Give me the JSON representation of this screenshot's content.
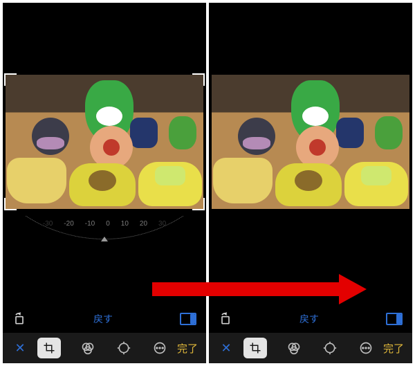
{
  "screens": {
    "left": {
      "reset_label": "戻す",
      "done_label": "完了",
      "show_crop_ui": true
    },
    "right": {
      "reset_label": "戻す",
      "done_label": "完了",
      "show_crop_ui": false
    }
  },
  "dial": {
    "labels": [
      "-30",
      "-20",
      "-10",
      "0",
      "10",
      "20",
      "30"
    ],
    "value": 0
  },
  "colors": {
    "accent_blue": "#2e6fd6",
    "accent_yellow": "#e2b93b",
    "arrow_red": "#e30000"
  },
  "icons": {
    "cancel": "cancel-x-icon",
    "crop": "crop-icon",
    "filters": "filters-icon",
    "adjust": "adjust-icon",
    "more": "more-icon",
    "rotate": "rotate-icon",
    "aspect": "aspect-ratio-icon"
  }
}
